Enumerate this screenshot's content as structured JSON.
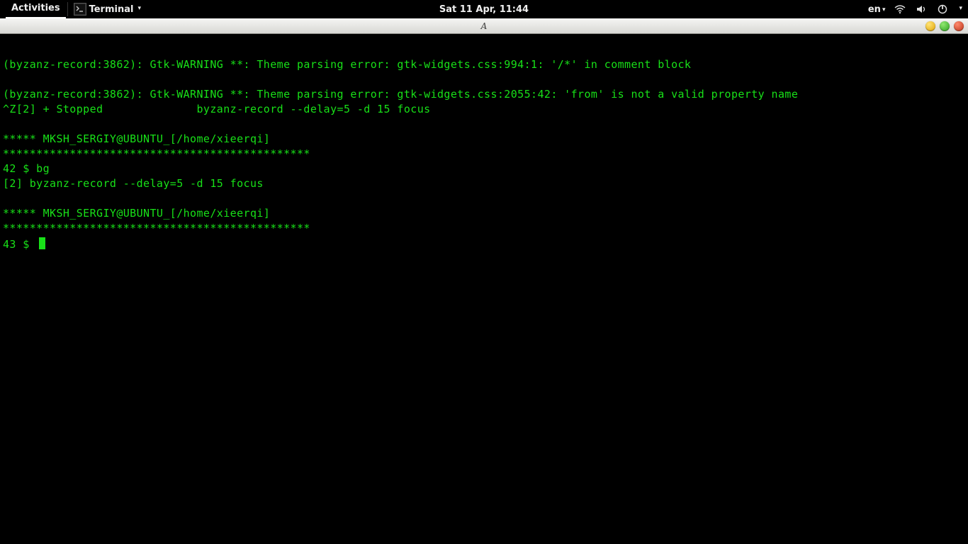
{
  "panel": {
    "activities": "Activities",
    "app_name": "Terminal",
    "clock": "Sat 11 Apr, 11:44",
    "input_lang": "en"
  },
  "window": {
    "title": "A"
  },
  "term": {
    "l0": "",
    "l1": "(byzanz-record:3862): Gtk-WARNING **: Theme parsing error: gtk-widgets.css:994:1: '/*' in comment block",
    "l2": "",
    "l3": "(byzanz-record:3862): Gtk-WARNING **: Theme parsing error: gtk-widgets.css:2055:42: 'from' is not a valid property name",
    "l4": "^Z[2] + Stopped              byzanz-record --delay=5 -d 15 focus",
    "l5": "",
    "l6": "***** MKSH_SERGIY@UBUNTU_[/home/xieerqi]",
    "l7": "**********************************************",
    "l8": "42 $ bg",
    "l9": "[2] byzanz-record --delay=5 -d 15 focus",
    "l10": "",
    "l11": "***** MKSH_SERGIY@UBUNTU_[/home/xieerqi]",
    "l12": "**********************************************",
    "l13": "43 $ "
  }
}
